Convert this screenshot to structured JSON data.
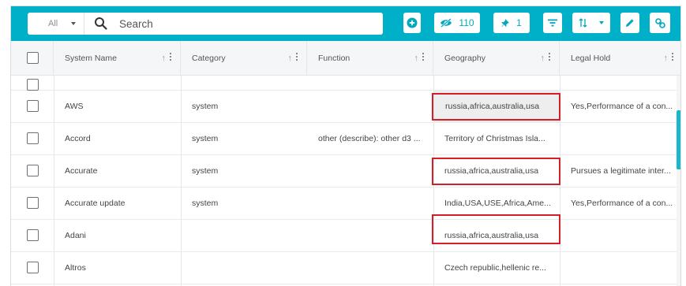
{
  "toolbar": {
    "filter_select": {
      "value": "All"
    },
    "search": {
      "placeholder": "Search"
    },
    "buttons": {
      "add": {
        "icon": "plus-circle-icon"
      },
      "hidden_columns": {
        "icon": "eye-slash-icon",
        "count": "110"
      },
      "pinned_columns": {
        "icon": "pin-icon",
        "count": "1"
      },
      "filter": {
        "icon": "filter-icon"
      },
      "sort": {
        "icon": "sort-icon"
      },
      "edit": {
        "icon": "pencil-icon"
      },
      "link": {
        "icon": "link-icon"
      }
    },
    "accent_color": "#00b0c8"
  },
  "table": {
    "columns": [
      {
        "label": "System Name"
      },
      {
        "label": "Category"
      },
      {
        "label": "Function"
      },
      {
        "label": "Geography"
      },
      {
        "label": "Legal Hold"
      }
    ],
    "rows": [
      {
        "system_name": "AWS",
        "category": "system",
        "function": "",
        "geography": "russia,africa,australia,usa",
        "legal_hold": "Yes,Performance of a con..."
      },
      {
        "system_name": "Accord",
        "category": "system",
        "function": "other (describe): other d3 ...",
        "geography": "Territory of Christmas Isla...",
        "legal_hold": ""
      },
      {
        "system_name": "Accurate",
        "category": "system",
        "function": "",
        "geography": "russia,africa,australia,usa",
        "legal_hold": "Pursues a legitimate inter..."
      },
      {
        "system_name": "Accurate update",
        "category": "system",
        "function": "",
        "geography": "India,USA,USE,Africa,Ame...",
        "legal_hold": "Yes,Performance of a con..."
      },
      {
        "system_name": "Adani",
        "category": "",
        "function": "",
        "geography": "russia,africa,australia,usa",
        "legal_hold": ""
      },
      {
        "system_name": "Altros",
        "category": "",
        "function": "",
        "geography": "Czech republic,hellenic re...",
        "legal_hold": ""
      }
    ],
    "highlight_color": "#d32028"
  }
}
